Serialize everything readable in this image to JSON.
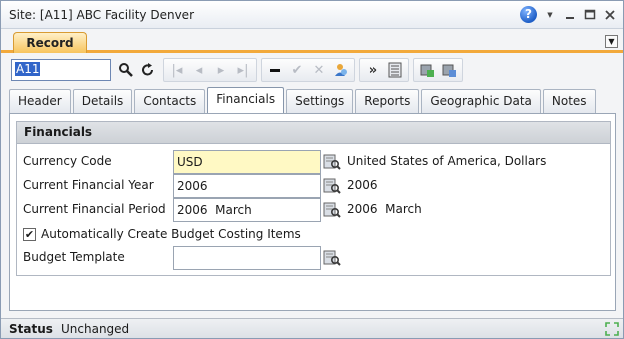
{
  "window": {
    "title": "Site: [A11] ABC Facility Denver"
  },
  "record_tab": {
    "label": "Record"
  },
  "toolbar": {
    "record_value": "A11"
  },
  "tabs": [
    {
      "label": "Header"
    },
    {
      "label": "Details"
    },
    {
      "label": "Contacts"
    },
    {
      "label": "Financials"
    },
    {
      "label": "Settings"
    },
    {
      "label": "Reports"
    },
    {
      "label": "Geographic Data"
    },
    {
      "label": "Notes"
    }
  ],
  "financials": {
    "section_title": "Financials",
    "currency_code": {
      "label": "Currency Code",
      "value": "USD",
      "description": "United States of America, Dollars"
    },
    "current_financial_year": {
      "label": "Current Financial Year",
      "value": "2006",
      "description": "2006"
    },
    "current_financial_period": {
      "label": "Current Financial Period",
      "value": "2006  March",
      "description": "2006  March"
    },
    "auto_budget": {
      "label": "Automatically Create Budget Costing Items",
      "checked": true
    },
    "budget_template": {
      "label": "Budget Template",
      "value": ""
    }
  },
  "status": {
    "label": "Status",
    "value": "Unchanged"
  },
  "colors": {
    "accent": "#f2a93b",
    "highlight_field": "#fff9c4",
    "selection": "#3165c9"
  },
  "icons": [
    "help-icon",
    "minimize-icon",
    "maximize-icon",
    "close-icon",
    "search-icon",
    "refresh-icon",
    "first-icon",
    "previous-icon",
    "next-icon",
    "last-icon",
    "minus-icon",
    "check-icon",
    "cancel-icon",
    "user-icon",
    "forward-icon",
    "list-icon",
    "lookup-icon",
    "resize-icon"
  ]
}
